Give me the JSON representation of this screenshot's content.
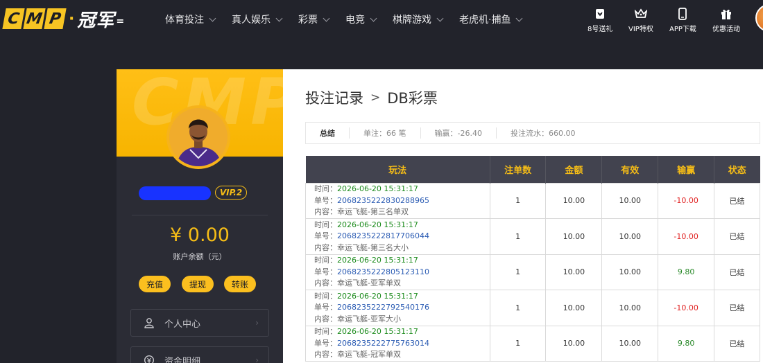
{
  "brand": {
    "letters": [
      "C",
      "M",
      "P"
    ],
    "dot": "·",
    "name": "冠军"
  },
  "nav": [
    {
      "label": "体育投注"
    },
    {
      "label": "真人娱乐"
    },
    {
      "label": "彩票"
    },
    {
      "label": "电竞"
    },
    {
      "label": "棋牌游戏"
    },
    {
      "label": "老虎机·捕鱼"
    }
  ],
  "quick_links": [
    {
      "label": "8号送礼",
      "icon": "gift-card-icon"
    },
    {
      "label": "VIP特权",
      "icon": "crown-icon"
    },
    {
      "label": "APP下载",
      "icon": "phone-icon"
    },
    {
      "label": "优惠活动",
      "icon": "gift-box-icon"
    }
  ],
  "sidebar": {
    "watermark": "CMP",
    "vip_level": "VIP.2",
    "balance": "¥ 0.00",
    "balance_label": "账户余额（元）",
    "buttons": {
      "deposit": "充值",
      "withdraw": "提现",
      "transfer": "转账"
    },
    "menu": [
      {
        "label": "个人中心",
        "icon": "user-icon"
      },
      {
        "label": "资金明细",
        "icon": "wallet-icon"
      }
    ],
    "arrow": "›"
  },
  "main": {
    "title": "投注记录",
    "separator": ">",
    "subtitle": "DB彩票",
    "summary": {
      "head": "总结",
      "bets": "单注：66 笔",
      "win_loss": "输赢：-26.40",
      "turnover": "投注流水：660.00"
    },
    "columns": [
      "玩法",
      "注单数",
      "金额",
      "有效",
      "输赢",
      "状态"
    ],
    "labels": {
      "time": "时间：",
      "order": "单号：",
      "content": "内容："
    },
    "rows": [
      {
        "time": "2026-06-20 15:31:17",
        "order": "2068235222830288965",
        "content": "幸运飞艇-第三名单双",
        "count": "1",
        "amount": "10.00",
        "valid": "10.00",
        "win": "-10.00",
        "win_type": "neg",
        "status": "已结"
      },
      {
        "time": "2026-06-20 15:31:17",
        "order": "2068235222817706044",
        "content": "幸运飞艇-第三名大小",
        "count": "1",
        "amount": "10.00",
        "valid": "10.00",
        "win": "-10.00",
        "win_type": "neg",
        "status": "已结"
      },
      {
        "time": "2026-06-20 15:31:17",
        "order": "2068235222805123110",
        "content": "幸运飞艇-亚军单双",
        "count": "1",
        "amount": "10.00",
        "valid": "10.00",
        "win": "9.80",
        "win_type": "pos",
        "status": "已结"
      },
      {
        "time": "2026-06-20 15:31:17",
        "order": "2068235222792540176",
        "content": "幸运飞艇-亚军大小",
        "count": "1",
        "amount": "10.00",
        "valid": "10.00",
        "win": "-10.00",
        "win_type": "neg",
        "status": "已结"
      },
      {
        "time": "2026-06-20 15:31:17",
        "order": "2068235222775763014",
        "content": "幸运飞艇-冠军单双",
        "count": "1",
        "amount": "10.00",
        "valid": "10.00",
        "win": "9.80",
        "win_type": "pos",
        "status": "已结"
      }
    ]
  },
  "colors": {
    "accent": "#f6bd16",
    "header_bg": "#22232b",
    "table_head": "#42434f",
    "loss": "#e02020",
    "gain": "#2b8a2b"
  }
}
